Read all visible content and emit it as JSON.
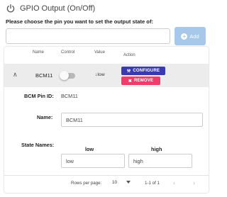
{
  "header": {
    "title": "GPIO Output (On/Off)",
    "icon": "power-icon"
  },
  "prompt": "Please choose the pin you want to set the output state of:",
  "add_button": {
    "label": "Add",
    "icon": "plus-circle-icon",
    "color": "#a7c8e8"
  },
  "table": {
    "columns": [
      "Name",
      "Control",
      "Value",
      "Action"
    ],
    "row": {
      "name": "BCM11",
      "value": "low",
      "value_icon": "arrow-down-icon",
      "toggle_on": false,
      "configure_label": "CONFIGURE",
      "configure_color": "#3a3ab0",
      "remove_label": "REMOVE",
      "remove_color": "#f03c6a"
    }
  },
  "details": {
    "pin_id_label": "BCM Pin ID:",
    "pin_id_value": "BCM11",
    "name_label": "Name:",
    "name_value": "BCM11",
    "state_names_label": "State Names:",
    "low_header": "low",
    "high_header": "high",
    "low_value": "low",
    "high_value": "high"
  },
  "footer": {
    "rows_per_page_label": "Rows per page:",
    "rows_per_page_value": "10",
    "range": "1-1 of 1"
  }
}
